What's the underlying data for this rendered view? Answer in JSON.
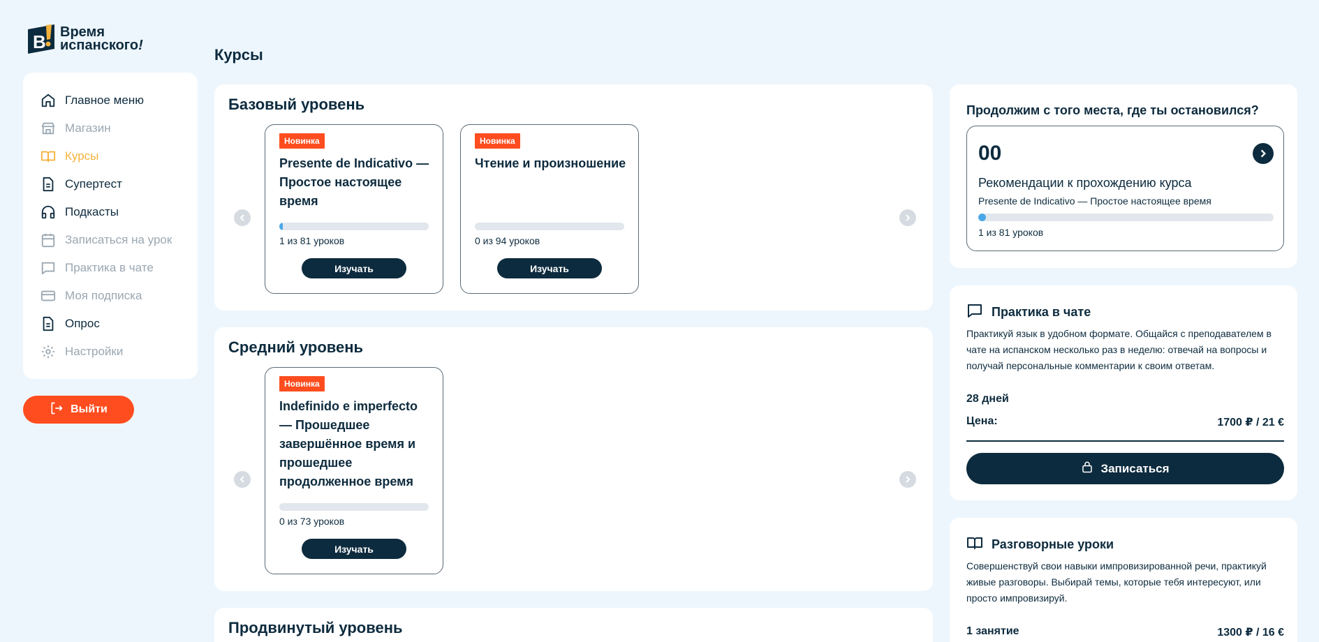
{
  "logo": {
    "line1": "Время",
    "line2": "испанского",
    "exclaim": "!",
    "mark_letter": "B",
    "mark_exclaim": "!"
  },
  "sidebar": {
    "items": [
      {
        "label": "Главное меню",
        "icon": "home-icon",
        "state": "active"
      },
      {
        "label": "Магазин",
        "icon": "store-icon",
        "state": "muted"
      },
      {
        "label": "Курсы",
        "icon": "book-icon",
        "state": "accent"
      },
      {
        "label": "Супертест",
        "icon": "document-icon",
        "state": "active"
      },
      {
        "label": "Подкасты",
        "icon": "headphones-icon",
        "state": "active"
      },
      {
        "label": "Записаться на урок",
        "icon": "calendar-icon",
        "state": "muted"
      },
      {
        "label": "Практика в чате",
        "icon": "chat-icon",
        "state": "muted"
      },
      {
        "label": "Моя подписка",
        "icon": "card-icon",
        "state": "muted"
      },
      {
        "label": "Опрос",
        "icon": "document-icon",
        "state": "active"
      },
      {
        "label": "Настройки",
        "icon": "gear-icon",
        "state": "muted"
      }
    ],
    "logout_label": "Выйти"
  },
  "page": {
    "title": "Курсы"
  },
  "sections": [
    {
      "title": "Базовый уровень",
      "cards": [
        {
          "badge": "Новинка",
          "title": "Presente de Indicativo — Простое настоящее время",
          "progress": 0.0123,
          "progress_text": "1 из 81 уроков",
          "button": "Изучать"
        },
        {
          "badge": "Новинка",
          "title": "Чтение и произношение",
          "progress": 0,
          "progress_text": "0 из 94 уроков",
          "button": "Изучать"
        }
      ]
    },
    {
      "title": "Средний уровень",
      "cards": [
        {
          "badge": "Новинка",
          "title": "Indefinido e imperfecto — Прошедшее завершённое время и прошедшее продолженное время",
          "progress": 0,
          "progress_text": "0 из 73 уроков",
          "button": "Изучать"
        }
      ]
    },
    {
      "title": "Продвинутый уровень",
      "cards": []
    }
  ],
  "continue": {
    "title": "Продолжим с того места, где ты остановился?",
    "number": "00",
    "heading": "Рекомендации к прохождению курса",
    "course": "Presente de Indicativo — Простое настоящее время",
    "progress": 0.0123,
    "progress_text": "1 из 81 уроков"
  },
  "chat_practice": {
    "title": "Практика в чате",
    "description": "Практикуй язык в удобном формате. Общайся с преподавателем в чате на испанском несколько раз в неделю: отвечай на вопросы и получай персональные комментарии к своим ответам.",
    "duration": "28 дней",
    "price_label": "Цена:",
    "price_value": "1700 ₽ / 21 €",
    "button": "Записаться"
  },
  "conversation": {
    "title": "Разговорные уроки",
    "description": "Совершенствуй свои навыки импровизированной речи, практикуй живые разговоры. Выбирай темы, которые тебя интересуют, или просто импровизируй.",
    "unit": "1 занятие",
    "price_value": "1300 ₽ / 16 €"
  },
  "colors": {
    "brand_dark": "#0d2b3e",
    "accent_orange": "#ff4d1f",
    "accent_yellow": "#f4b23c",
    "progress_blue": "#4aa8e8",
    "background": "#eef6fd"
  }
}
